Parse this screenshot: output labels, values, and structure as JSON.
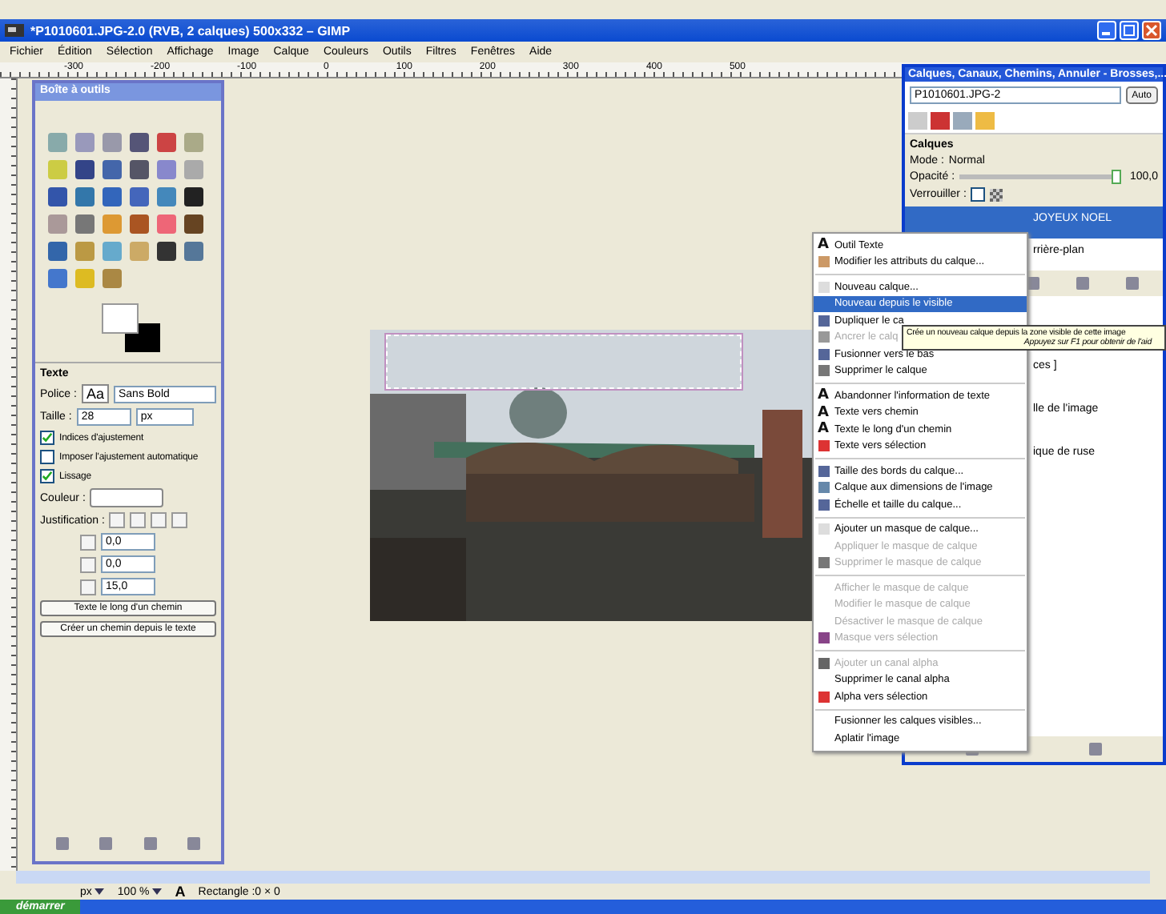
{
  "window": {
    "title": "*P1010601.JPG-2.0 (RVB, 2 calques) 500x332 – GIMP"
  },
  "menu_bar": [
    "Fichier",
    "Édition",
    "Sélection",
    "Affichage",
    "Image",
    "Calque",
    "Couleurs",
    "Outils",
    "Filtres",
    "Fenêtres",
    "Aide"
  ],
  "ruler": [
    "-300",
    "-200",
    "-100",
    "0",
    "100",
    "200",
    "300",
    "400",
    "500"
  ],
  "toolbox": {
    "title": "Boîte à outils",
    "section": "Texte",
    "font_label": "Police :",
    "font_preview": "Aa",
    "font": "Sans Bold",
    "size_label": "Taille :",
    "size": "28",
    "unit": "px",
    "options": [
      {
        "label": "Indices d'ajustement",
        "checked": true
      },
      {
        "label": "Imposer l'ajustement automatique",
        "checked": false
      },
      {
        "label": "Lissage",
        "checked": true
      }
    ],
    "color_label": "Couleur :",
    "justify_label": "Justification :",
    "spacing": [
      "0,0",
      "0,0",
      "15,0"
    ],
    "buttons": [
      "Texte le long d'un chemin",
      "Créer un chemin depuis le texte"
    ]
  },
  "dock": {
    "title": "Calques, Canaux, Chemins, Annuler - Brosses,...",
    "image": "P1010601.JPG-2",
    "auto": "Auto",
    "layers_title": "Calques",
    "mode_label": "Mode :",
    "mode": "Normal",
    "opacity_label": "Opacité :",
    "opacity": {
      "level": 1,
      "value": "100,0"
    },
    "lock_label": "Verrouiller :",
    "lock_checked": false,
    "layers": [
      {
        "name": "JOYEUX NOEL",
        "selected": true
      },
      {
        "name": "rrière-plan",
        "selected": false
      }
    ],
    "lower_texts": [
      "ces ]",
      "lle de l'image",
      "ique de ruse"
    ]
  },
  "context_menu": {
    "groups": [
      [
        {
          "label": "Outil Texte",
          "kind": "glyph",
          "glyph": "A",
          "disabled": false,
          "selected": false
        },
        {
          "label": "Modifier les attributs du calque...",
          "kind": "edit",
          "disabled": false,
          "selected": false
        }
      ],
      [
        {
          "label": "Nouveau calque...",
          "kind": "doc",
          "disabled": false,
          "selected": false
        },
        {
          "label": "Nouveau depuis le visible",
          "kind": "plain",
          "disabled": false,
          "selected": true
        },
        {
          "label": "Dupliquer le ca",
          "kind": "layers",
          "disabled": false,
          "selected": false
        },
        {
          "label": "Ancrer le calq",
          "kind": "anchor",
          "disabled": true,
          "selected": false
        },
        {
          "label": "Fusionner vers le bas",
          "kind": "layers",
          "disabled": false,
          "selected": false
        },
        {
          "label": "Supprimer le calque",
          "kind": "trash",
          "disabled": false,
          "selected": false
        }
      ],
      [
        {
          "label": "Abandonner l'information de texte",
          "kind": "glyph",
          "glyph": "A",
          "disabled": false,
          "selected": false
        },
        {
          "label": "Texte vers chemin",
          "kind": "glyph",
          "glyph": "A",
          "disabled": false,
          "selected": false
        },
        {
          "label": "Texte le long d'un chemin",
          "kind": "glyph",
          "glyph": "A",
          "disabled": false,
          "selected": false
        },
        {
          "label": "Texte vers sélection",
          "kind": "selection",
          "disabled": false,
          "selected": false
        }
      ],
      [
        {
          "label": "Taille des bords du calque...",
          "kind": "layers",
          "disabled": false,
          "selected": false
        },
        {
          "label": "Calque aux dimensions de l'image",
          "kind": "resize",
          "disabled": false,
          "selected": false
        },
        {
          "label": "Échelle et taille du calque...",
          "kind": "layers",
          "disabled": false,
          "selected": false
        }
      ],
      [
        {
          "label": "Ajouter un masque de calque...",
          "kind": "doc",
          "disabled": false,
          "selected": false
        },
        {
          "label": "Appliquer le masque de calque",
          "kind": "plain",
          "disabled": true,
          "selected": false
        },
        {
          "label": "Supprimer le masque de calque",
          "kind": "trash",
          "disabled": true,
          "selected": false
        }
      ],
      [
        {
          "label": "Afficher le masque de calque",
          "kind": "plain",
          "disabled": true,
          "selected": false
        },
        {
          "label": "Modifier le masque de calque",
          "kind": "plain",
          "disabled": true,
          "selected": false
        },
        {
          "label": "Désactiver le masque de calque",
          "kind": "plain",
          "disabled": true,
          "selected": false
        },
        {
          "label": "Masque vers sélection",
          "kind": "mask",
          "disabled": true,
          "selected": false
        }
      ],
      [
        {
          "label": "Ajouter un canal alpha",
          "kind": "checker",
          "disabled": true,
          "selected": false
        },
        {
          "label": "Supprimer le canal alpha",
          "kind": "plain",
          "disabled": false,
          "selected": false
        },
        {
          "label": "Alpha vers sélection",
          "kind": "selection",
          "disabled": false,
          "selected": false
        }
      ],
      [
        {
          "label": "Fusionner les calques visibles...",
          "kind": "plain",
          "disabled": false,
          "selected": false
        },
        {
          "label": "Aplatir l'image",
          "kind": "plain",
          "disabled": false,
          "selected": false
        }
      ]
    ]
  },
  "tooltip": {
    "text": "Crée un nouveau calque depuis la zone visible de cette image",
    "hint": "Appuyez sur F1 pour obtenir de l'aid"
  },
  "status_bar": {
    "unit": "px",
    "zoom": "100 %",
    "tool_glyph": "A",
    "message": "Rectangle :0 × 0"
  },
  "taskbar": {
    "start": "démarrer"
  }
}
